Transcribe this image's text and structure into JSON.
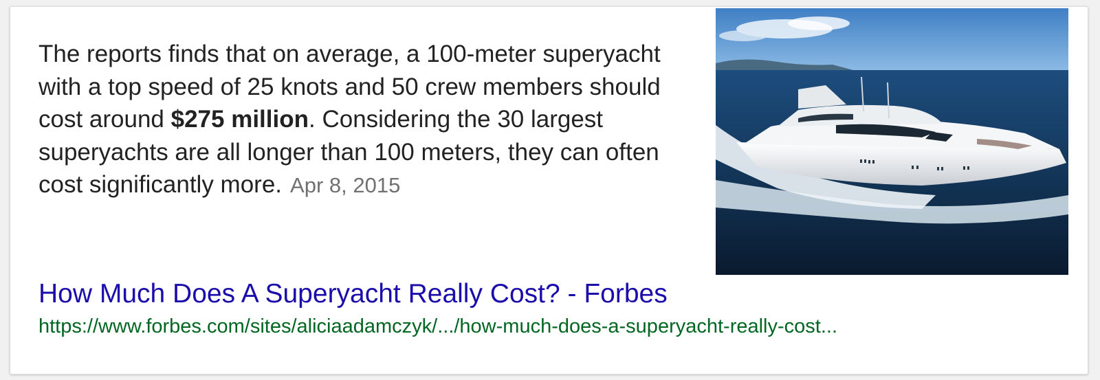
{
  "snippet": {
    "text_before": "The reports finds that on average, a 100-meter superyacht with a top speed of 25 knots and 50 crew members should cost around ",
    "bold_text": "$275 million",
    "text_after": ". Considering the 30 largest superyachts are all longer than 100 meters, they can often cost significantly more.",
    "date": "Apr 8, 2015"
  },
  "image": {
    "icon": "superyacht-photo"
  },
  "result": {
    "title": "How Much Does A Superyacht Really Cost? - Forbes",
    "url": "https://www.forbes.com/sites/aliciaadamczyk/.../how-much-does-a-superyacht-really-cost..."
  },
  "colors": {
    "link": "#1a0dab",
    "url": "#006621",
    "date": "#707070",
    "text": "#222222"
  }
}
